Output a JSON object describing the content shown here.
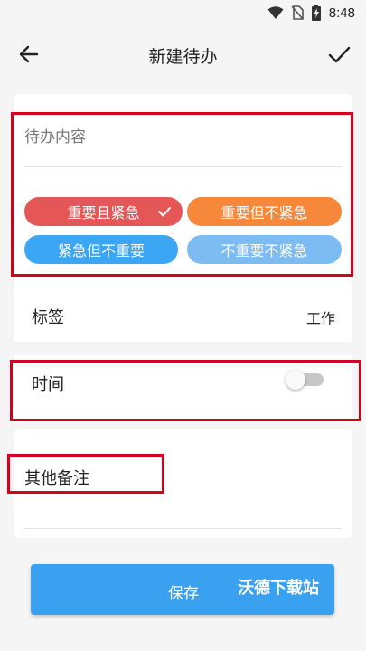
{
  "status_bar": {
    "time": "8:48"
  },
  "toolbar": {
    "title": "新建待办"
  },
  "content": {
    "placeholder": "待办内容"
  },
  "priority_chips": [
    {
      "label": "重要且紧急",
      "selected": true,
      "color": "#e55757"
    },
    {
      "label": "重要但不紧急",
      "selected": false,
      "color": "#f5883a"
    },
    {
      "label": "紧急但不重要",
      "selected": false,
      "color": "#3ba6f4"
    },
    {
      "label": "不重要不紧急",
      "selected": false,
      "color": "#7cbcf2"
    }
  ],
  "tag_row": {
    "label": "标签",
    "value": "工作"
  },
  "time_row": {
    "label": "时间",
    "enabled": false
  },
  "note_row": {
    "label": "其他备注"
  },
  "save_button": {
    "label": "保存"
  },
  "watermark": {
    "text": "沃德下载站"
  },
  "colors": {
    "accent": "#3aa0f0",
    "highlight_box": "#d4001f"
  }
}
